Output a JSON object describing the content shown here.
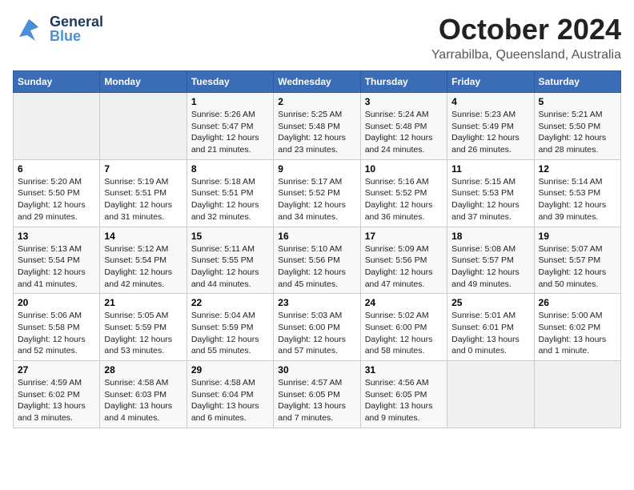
{
  "header": {
    "logo_general": "General",
    "logo_blue": "Blue",
    "month": "October 2024",
    "location": "Yarrabilba, Queensland, Australia"
  },
  "days_of_week": [
    "Sunday",
    "Monday",
    "Tuesday",
    "Wednesday",
    "Thursday",
    "Friday",
    "Saturday"
  ],
  "weeks": [
    [
      {
        "day": "",
        "info": ""
      },
      {
        "day": "",
        "info": ""
      },
      {
        "day": "1",
        "info": "Sunrise: 5:26 AM\nSunset: 5:47 PM\nDaylight: 12 hours and 21 minutes."
      },
      {
        "day": "2",
        "info": "Sunrise: 5:25 AM\nSunset: 5:48 PM\nDaylight: 12 hours and 23 minutes."
      },
      {
        "day": "3",
        "info": "Sunrise: 5:24 AM\nSunset: 5:48 PM\nDaylight: 12 hours and 24 minutes."
      },
      {
        "day": "4",
        "info": "Sunrise: 5:23 AM\nSunset: 5:49 PM\nDaylight: 12 hours and 26 minutes."
      },
      {
        "day": "5",
        "info": "Sunrise: 5:21 AM\nSunset: 5:50 PM\nDaylight: 12 hours and 28 minutes."
      }
    ],
    [
      {
        "day": "6",
        "info": "Sunrise: 5:20 AM\nSunset: 5:50 PM\nDaylight: 12 hours and 29 minutes."
      },
      {
        "day": "7",
        "info": "Sunrise: 5:19 AM\nSunset: 5:51 PM\nDaylight: 12 hours and 31 minutes."
      },
      {
        "day": "8",
        "info": "Sunrise: 5:18 AM\nSunset: 5:51 PM\nDaylight: 12 hours and 32 minutes."
      },
      {
        "day": "9",
        "info": "Sunrise: 5:17 AM\nSunset: 5:52 PM\nDaylight: 12 hours and 34 minutes."
      },
      {
        "day": "10",
        "info": "Sunrise: 5:16 AM\nSunset: 5:52 PM\nDaylight: 12 hours and 36 minutes."
      },
      {
        "day": "11",
        "info": "Sunrise: 5:15 AM\nSunset: 5:53 PM\nDaylight: 12 hours and 37 minutes."
      },
      {
        "day": "12",
        "info": "Sunrise: 5:14 AM\nSunset: 5:53 PM\nDaylight: 12 hours and 39 minutes."
      }
    ],
    [
      {
        "day": "13",
        "info": "Sunrise: 5:13 AM\nSunset: 5:54 PM\nDaylight: 12 hours and 41 minutes."
      },
      {
        "day": "14",
        "info": "Sunrise: 5:12 AM\nSunset: 5:54 PM\nDaylight: 12 hours and 42 minutes."
      },
      {
        "day": "15",
        "info": "Sunrise: 5:11 AM\nSunset: 5:55 PM\nDaylight: 12 hours and 44 minutes."
      },
      {
        "day": "16",
        "info": "Sunrise: 5:10 AM\nSunset: 5:56 PM\nDaylight: 12 hours and 45 minutes."
      },
      {
        "day": "17",
        "info": "Sunrise: 5:09 AM\nSunset: 5:56 PM\nDaylight: 12 hours and 47 minutes."
      },
      {
        "day": "18",
        "info": "Sunrise: 5:08 AM\nSunset: 5:57 PM\nDaylight: 12 hours and 49 minutes."
      },
      {
        "day": "19",
        "info": "Sunrise: 5:07 AM\nSunset: 5:57 PM\nDaylight: 12 hours and 50 minutes."
      }
    ],
    [
      {
        "day": "20",
        "info": "Sunrise: 5:06 AM\nSunset: 5:58 PM\nDaylight: 12 hours and 52 minutes."
      },
      {
        "day": "21",
        "info": "Sunrise: 5:05 AM\nSunset: 5:59 PM\nDaylight: 12 hours and 53 minutes."
      },
      {
        "day": "22",
        "info": "Sunrise: 5:04 AM\nSunset: 5:59 PM\nDaylight: 12 hours and 55 minutes."
      },
      {
        "day": "23",
        "info": "Sunrise: 5:03 AM\nSunset: 6:00 PM\nDaylight: 12 hours and 57 minutes."
      },
      {
        "day": "24",
        "info": "Sunrise: 5:02 AM\nSunset: 6:00 PM\nDaylight: 12 hours and 58 minutes."
      },
      {
        "day": "25",
        "info": "Sunrise: 5:01 AM\nSunset: 6:01 PM\nDaylight: 13 hours and 0 minutes."
      },
      {
        "day": "26",
        "info": "Sunrise: 5:00 AM\nSunset: 6:02 PM\nDaylight: 13 hours and 1 minute."
      }
    ],
    [
      {
        "day": "27",
        "info": "Sunrise: 4:59 AM\nSunset: 6:02 PM\nDaylight: 13 hours and 3 minutes."
      },
      {
        "day": "28",
        "info": "Sunrise: 4:58 AM\nSunset: 6:03 PM\nDaylight: 13 hours and 4 minutes."
      },
      {
        "day": "29",
        "info": "Sunrise: 4:58 AM\nSunset: 6:04 PM\nDaylight: 13 hours and 6 minutes."
      },
      {
        "day": "30",
        "info": "Sunrise: 4:57 AM\nSunset: 6:05 PM\nDaylight: 13 hours and 7 minutes."
      },
      {
        "day": "31",
        "info": "Sunrise: 4:56 AM\nSunset: 6:05 PM\nDaylight: 13 hours and 9 minutes."
      },
      {
        "day": "",
        "info": ""
      },
      {
        "day": "",
        "info": ""
      }
    ]
  ]
}
